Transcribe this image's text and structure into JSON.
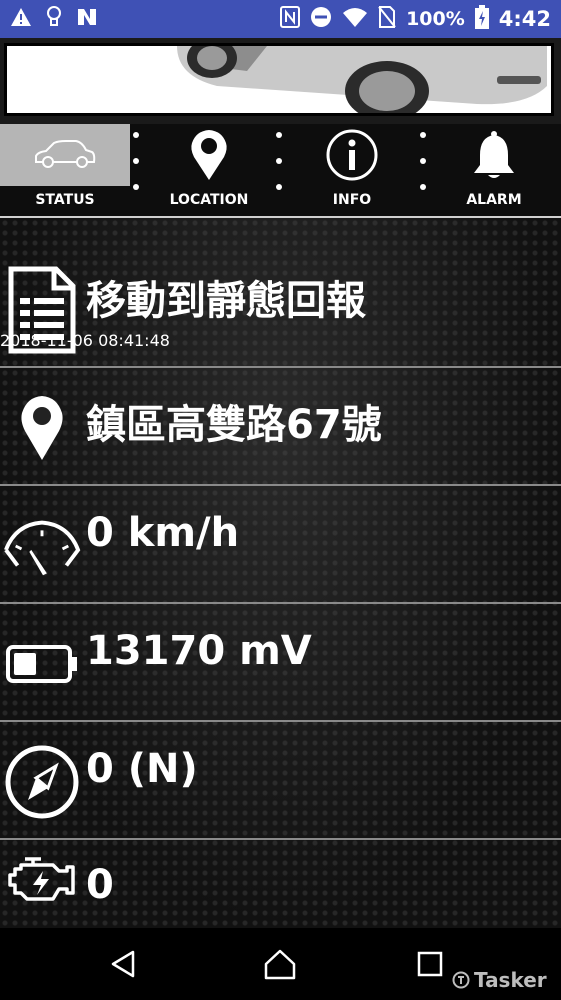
{
  "statusbar": {
    "battery_pct": "100%",
    "time": "4:42",
    "icons": [
      "warning-icon",
      "lightbulb-icon",
      "app-n-icon",
      "nfc-icon",
      "do-not-disturb-icon",
      "wifi-icon",
      "no-sim-icon",
      "battery-charging-icon"
    ]
  },
  "banner": {
    "image": "car-photo"
  },
  "tabs": [
    {
      "label": "STATUS",
      "icon": "car-icon",
      "active": true
    },
    {
      "label": "LOCATION",
      "icon": "location-pin-icon",
      "active": false
    },
    {
      "label": "INFO",
      "icon": "info-icon",
      "active": false
    },
    {
      "label": "ALARM",
      "icon": "bell-icon",
      "active": false
    }
  ],
  "rows": {
    "report": {
      "title": "移動到靜態回報",
      "timestamp": "2018-11-06 08:41:48",
      "icon": "document-icon"
    },
    "address": {
      "value": "鎮區高雙路67號",
      "icon": "location-pin-icon"
    },
    "speed": {
      "value": "0 km/h",
      "icon": "speedometer-icon"
    },
    "voltage": {
      "value": "13170 mV",
      "icon": "battery-icon"
    },
    "heading": {
      "value": "0 (N)",
      "icon": "compass-icon"
    },
    "engine": {
      "value": "0",
      "icon": "engine-icon"
    }
  },
  "navbar": {
    "buttons": [
      "back",
      "home",
      "recents"
    ],
    "watermark": "Tasker"
  },
  "colors": {
    "statusbar": "#3f51b5",
    "active_tab": "#b5b5b5",
    "divider": "#8a8a8a"
  }
}
